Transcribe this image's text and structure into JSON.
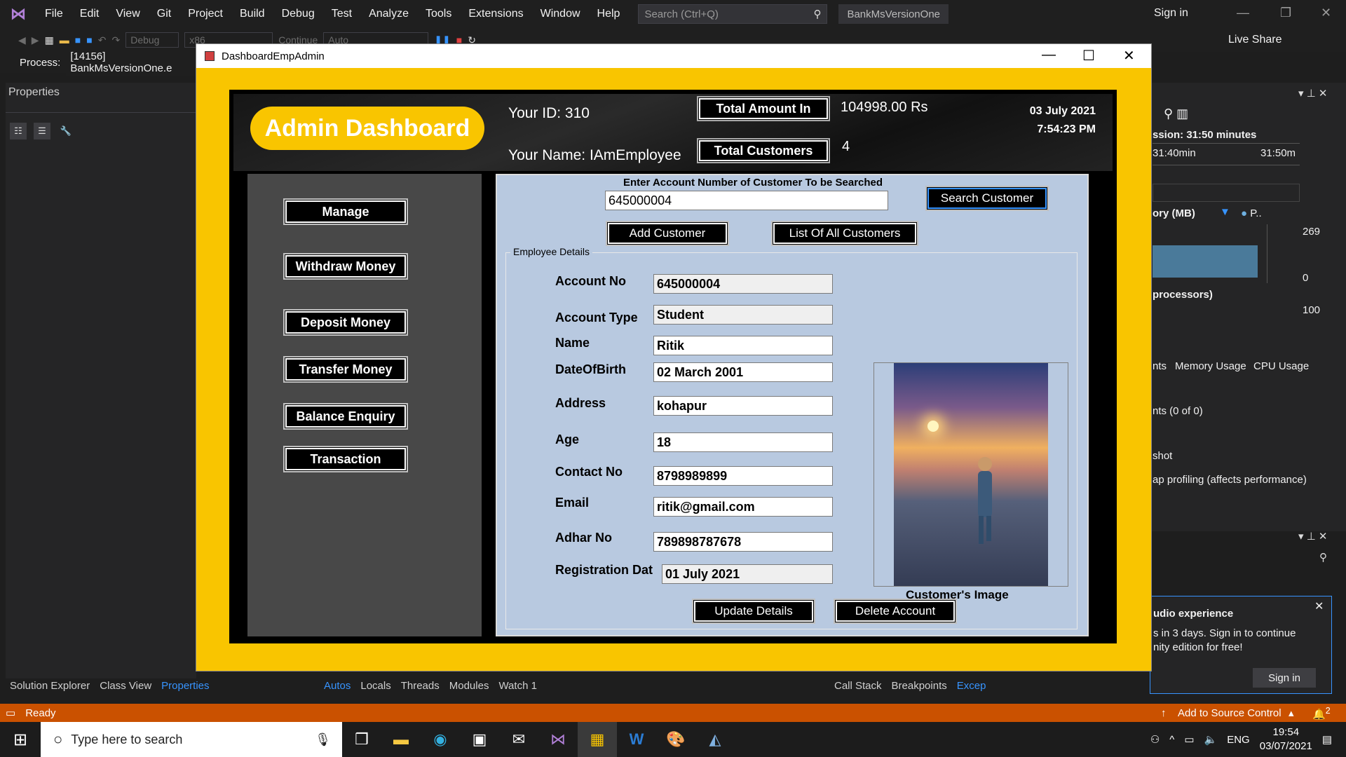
{
  "vs": {
    "menu": [
      "File",
      "Edit",
      "View",
      "Git",
      "Project",
      "Build",
      "Debug",
      "Test",
      "Analyze",
      "Tools",
      "Extensions",
      "Window",
      "Help"
    ],
    "search_placeholder": "Search (Ctrl+Q)",
    "project_name": "BankMsVersionOne",
    "sign_in": "Sign in",
    "live_share": "Live Share",
    "toolbar": {
      "config": "Debug",
      "platform": "x86",
      "continue": "Continue",
      "auto": "Auto"
    },
    "process_label": "Process:",
    "process_value": "[14156] BankMsVersionOne.e",
    "properties_title": "Properties",
    "left_tabs": [
      "Solution Explorer",
      "Class View",
      "Properties"
    ],
    "debug_tabs": [
      "Autos",
      "Locals",
      "Threads",
      "Modules",
      "Watch 1"
    ],
    "right_tabs": [
      "Call Stack",
      "Breakpoints",
      "Excep"
    ],
    "status": "Ready",
    "source_control": "Add to Source Control",
    "notif_count": "2",
    "diag": {
      "session": "ssion: 31:50 minutes",
      "t1": "31:40min",
      "t2": "31:50m",
      "memory": "ory (MB)",
      "mem_legend": "P..",
      "mem_max": "269",
      "mem_min": "0",
      "cpu": "processors)",
      "cpu_max": "100",
      "tab_events": "nts",
      "tab_memory": "Memory Usage",
      "tab_cpu": "CPU Usage",
      "events_count": "nts (0 of 0)",
      "shot": "shot",
      "heap": "ap profiling (affects performance)",
      "promo_title": "udio experience",
      "promo_text1": "s in 3 days. Sign in to continue",
      "promo_text2": "nity edition for free!",
      "promo_btn": "Sign in"
    }
  },
  "taskbar": {
    "search_placeholder": "Type here to search",
    "time": "19:54",
    "date": "03/07/2021",
    "lang": "ENG"
  },
  "form": {
    "title": "DashboardEmpAdmin",
    "header": {
      "badge": "Admin Dashboard",
      "your_id": "Your ID: 310",
      "your_name": "Your Name: IAmEmployee",
      "total_amount_label": "Total Amount In",
      "total_amount_value": "104998.00 Rs",
      "total_customers_label": "Total Customers",
      "total_customers_value": "4",
      "date": "03 July 2021",
      "time": "7:54:23 PM"
    },
    "sidebar": [
      "Manage",
      "Withdraw Money",
      "Deposit Money",
      "Transfer Money",
      "Balance Enquiry",
      "Transaction"
    ],
    "search": {
      "label": "Enter Account Number of Customer To be Searched",
      "value": "645000004",
      "search_btn": "Search Customer",
      "add_btn": "Add Customer",
      "list_btn": "List Of All Customers"
    },
    "details": {
      "legend": "Employee Details",
      "fields": [
        {
          "label": "Account No",
          "value": "645000004"
        },
        {
          "label": "Account Type",
          "value": "Student"
        },
        {
          "label": "Name",
          "value": "Ritik"
        },
        {
          "label": "DateOfBirth",
          "value": "02 March 2001"
        },
        {
          "label": "Address",
          "value": "kohapur"
        },
        {
          "label": "Age",
          "value": "18"
        },
        {
          "label": "Contact No",
          "value": "8798989899"
        },
        {
          "label": "Email",
          "value": "ritik@gmail.com"
        },
        {
          "label": "Adhar No",
          "value": "789898787678"
        },
        {
          "label": "Registration Dat",
          "value": "01 July 2021"
        }
      ],
      "image_caption": "Customer's Image",
      "update_btn": "Update Details",
      "delete_btn": "Delete Account"
    }
  }
}
